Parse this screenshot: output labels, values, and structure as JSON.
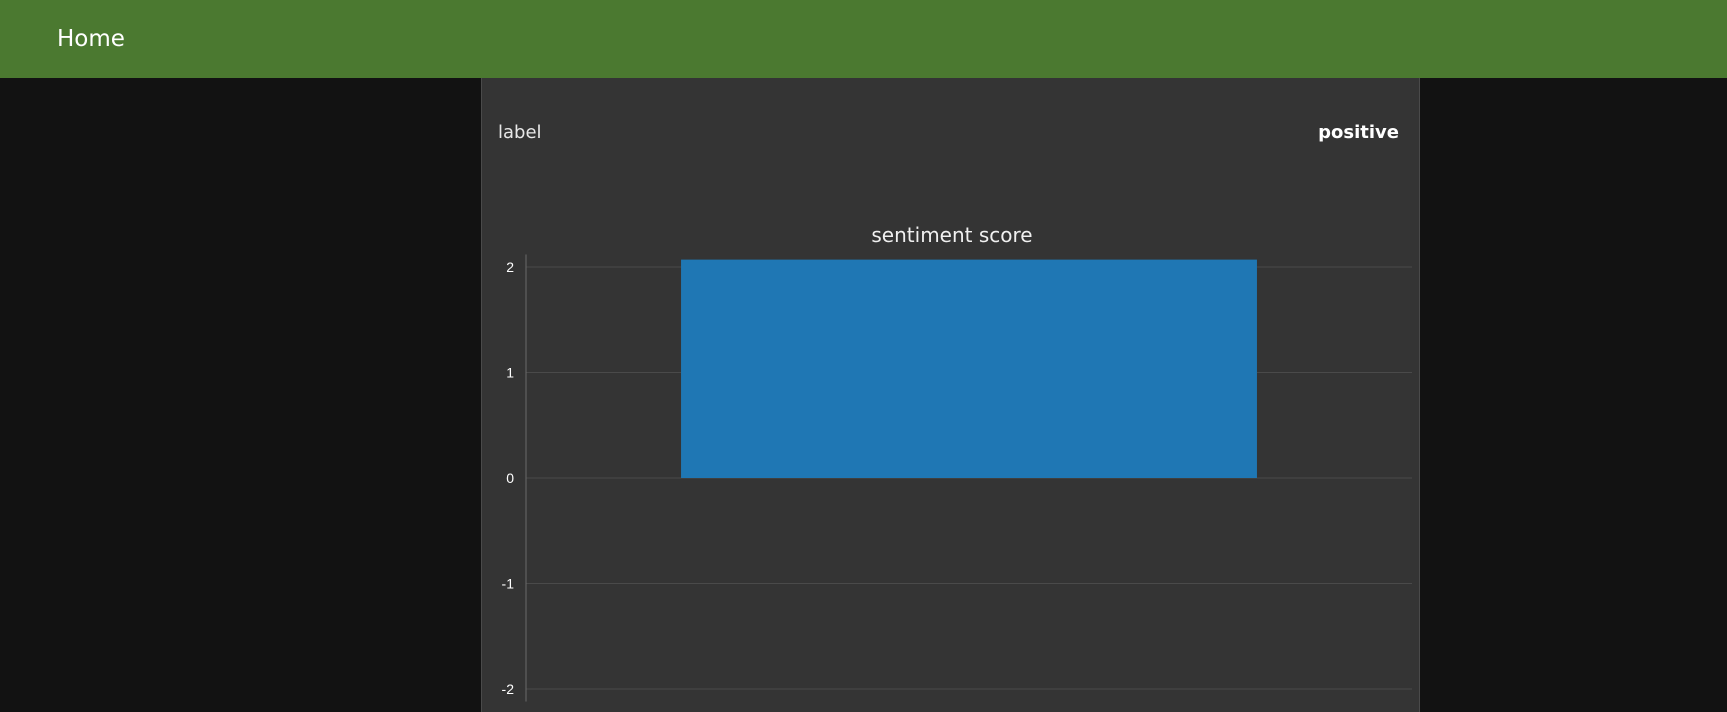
{
  "header": {
    "home_label": "Home"
  },
  "details": {
    "key": "label",
    "value": "positive"
  },
  "colors": {
    "header_bg": "#4b7930",
    "panel_bg": "#343434",
    "bar": "#1f77b4"
  },
  "chart_data": {
    "type": "bar",
    "title": "sentiment score",
    "xlabel": "",
    "ylabel": "",
    "categories": [
      ""
    ],
    "values": [
      2.07
    ],
    "ylim": [
      -2.1,
      2.1
    ],
    "yticks": [
      2,
      1,
      0,
      -1,
      -2
    ],
    "grid": true
  }
}
